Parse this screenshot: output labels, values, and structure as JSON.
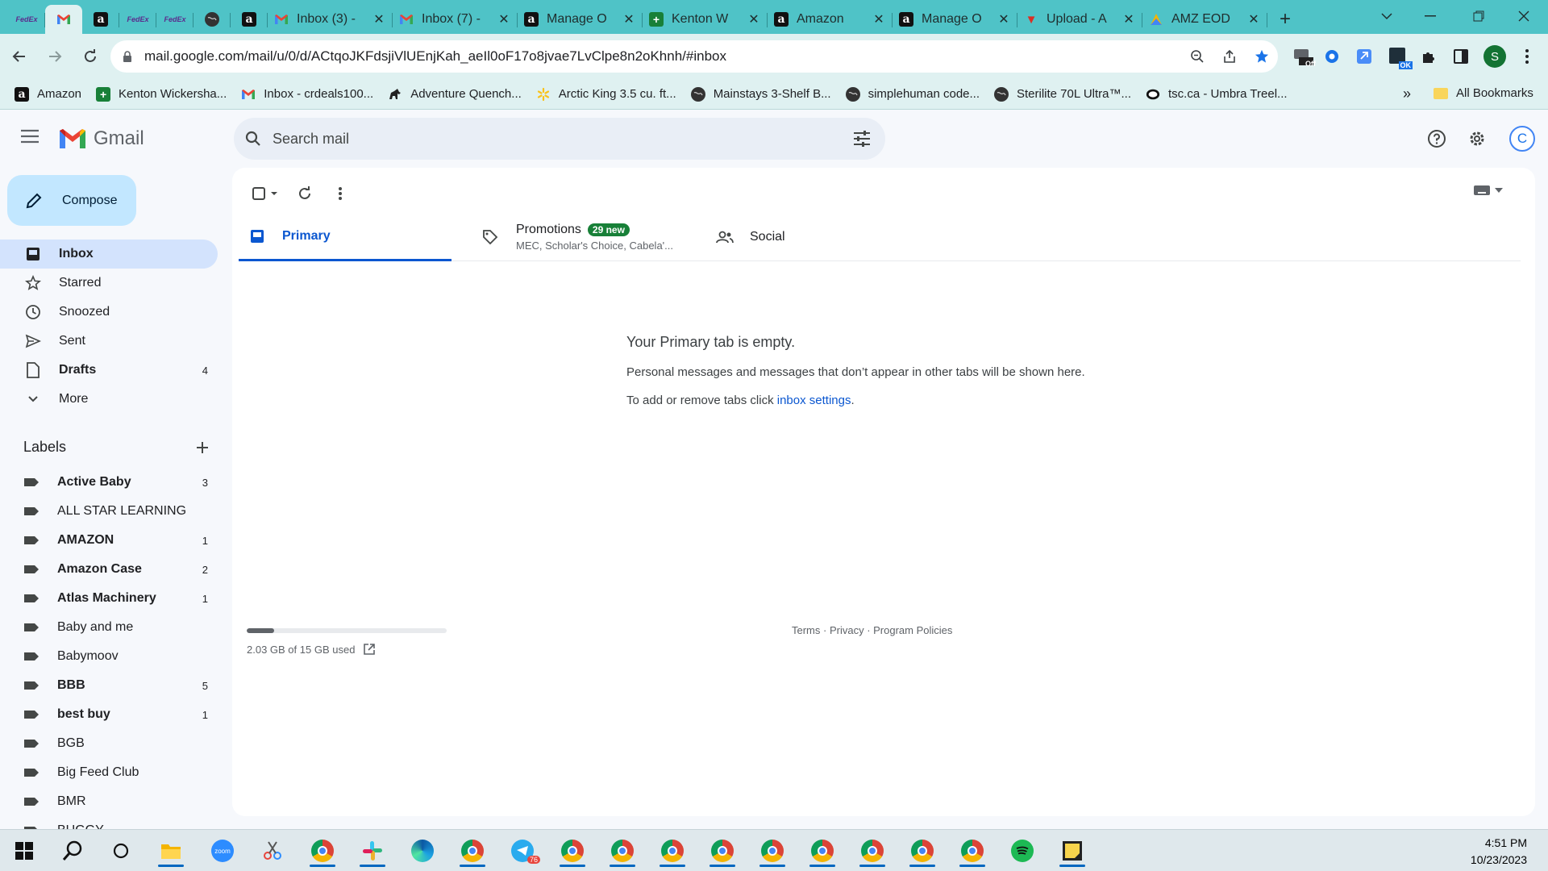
{
  "browser": {
    "tabs": [
      {
        "label": "",
        "favicon": "fedex"
      },
      {
        "label": "",
        "favicon": "gmail",
        "active": true
      },
      {
        "label": "",
        "favicon": "amazon"
      },
      {
        "label": "",
        "favicon": "fedex"
      },
      {
        "label": "",
        "favicon": "fedex"
      },
      {
        "label": "",
        "favicon": "globe"
      },
      {
        "label": "",
        "favicon": "amazon"
      },
      {
        "label": "Inbox (3) -",
        "favicon": "gmail"
      },
      {
        "label": "Inbox (7) -",
        "favicon": "gmail"
      },
      {
        "label": "Manage O",
        "favicon": "amazon"
      },
      {
        "label": "Kenton W",
        "favicon": "sheets"
      },
      {
        "label": "Amazon",
        "favicon": "amazon"
      },
      {
        "label": "Manage O",
        "favicon": "amazon"
      },
      {
        "label": "Upload - A",
        "favicon": "vee"
      },
      {
        "label": "AMZ EOD",
        "favicon": "amz-color"
      }
    ],
    "close_glyph": "✕",
    "new_tab_glyph": "+",
    "url": "mail.google.com/mail/u/0/d/ACtqoJKFdsjiVlUEnjKah_aeIl0oF17o8jvae7LvClpe8n2oKhnh/#inbox",
    "profile_initial": "S",
    "ext_badge_off": "Off",
    "ext_badge_ok": "OK"
  },
  "bookmarks": {
    "items": [
      {
        "label": "Amazon",
        "favicon": "amazon"
      },
      {
        "label": "Kenton Wickersha...",
        "favicon": "sheets"
      },
      {
        "label": "Inbox - crdeals100...",
        "favicon": "gmail"
      },
      {
        "label": "Adventure Quench...",
        "favicon": "horse"
      },
      {
        "label": "Arctic King 3.5 cu. ft...",
        "favicon": "walmart"
      },
      {
        "label": "Mainstays 3-Shelf B...",
        "favicon": "globe"
      },
      {
        "label": "simplehuman code...",
        "favicon": "globe"
      },
      {
        "label": "Sterilite 70L Ultra™...",
        "favicon": "globe"
      },
      {
        "label": "tsc.ca - Umbra Treel...",
        "favicon": "tsc"
      }
    ],
    "more_glyph": "»",
    "all_label": "All Bookmarks"
  },
  "gmail": {
    "logo_text": "Gmail",
    "search_placeholder": "Search mail",
    "account_initial": "C",
    "compose_label": "Compose",
    "nav": [
      {
        "label": "Inbox",
        "icon": "inbox-icon",
        "count": "",
        "active": true
      },
      {
        "label": "Starred",
        "icon": "star-icon",
        "count": ""
      },
      {
        "label": "Snoozed",
        "icon": "clock-icon",
        "count": ""
      },
      {
        "label": "Sent",
        "icon": "send-icon",
        "count": ""
      },
      {
        "label": "Drafts",
        "icon": "draft-icon",
        "count": "4",
        "bold": true
      },
      {
        "label": "More",
        "icon": "chevron-down-icon",
        "count": ""
      }
    ],
    "labels_title": "Labels",
    "labels": [
      {
        "label": "Active Baby",
        "count": "3",
        "bold": true
      },
      {
        "label": "ALL STAR LEARNING",
        "count": ""
      },
      {
        "label": "AMAZON",
        "count": "1",
        "bold": true
      },
      {
        "label": "Amazon Case",
        "count": "2",
        "bold": true
      },
      {
        "label": "Atlas Machinery",
        "count": "1",
        "bold": true
      },
      {
        "label": "Baby and me",
        "count": ""
      },
      {
        "label": "Babymoov",
        "count": ""
      },
      {
        "label": "BBB",
        "count": "5",
        "bold": true
      },
      {
        "label": "best buy",
        "count": "1",
        "bold": true
      },
      {
        "label": "BGB",
        "count": ""
      },
      {
        "label": "Big Feed Club",
        "count": ""
      },
      {
        "label": "BMR",
        "count": ""
      },
      {
        "label": "BUGGY",
        "count": ""
      }
    ],
    "tabs": {
      "primary": "Primary",
      "promotions": "Promotions",
      "promotions_badge": "29 new",
      "promotions_sub": "MEC, Scholar's Choice, Cabela'...",
      "social": "Social"
    },
    "empty": {
      "title": "Your Primary tab is empty.",
      "line1": "Personal messages and messages that don’t appear in other tabs will be shown here.",
      "line2_prefix": "To add or remove tabs click ",
      "line2_link": "inbox settings",
      "line2_suffix": "."
    },
    "storage": {
      "text": "2.03 GB of 15 GB used",
      "used_gb": 2.03,
      "total_gb": 15
    },
    "footer": {
      "terms": "Terms",
      "privacy": "Privacy",
      "policies": "Program Policies",
      "sep": " · "
    }
  },
  "taskbar": {
    "time": "4:51 PM",
    "date": "10/23/2023",
    "telegram_badge": "76",
    "zoom_label": "zoom"
  },
  "colors": {
    "tabstrip": "#4fc3c7",
    "toolbar": "#dff1f1",
    "gmail_bg": "#f6f8fc",
    "compose": "#c2e7ff",
    "active_nav": "#d3e3fd",
    "accent_blue": "#0b57d0",
    "badge_green": "#188038"
  }
}
